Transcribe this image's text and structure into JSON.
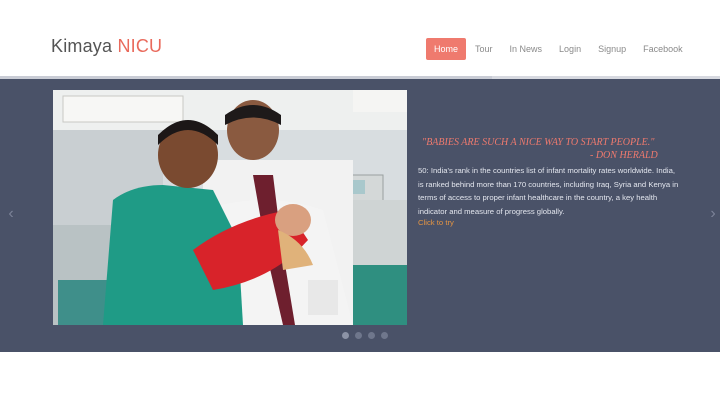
{
  "header": {
    "logo_main": "Kimaya",
    "logo_accent": "NICU"
  },
  "nav": {
    "items": [
      {
        "label": "Home",
        "active": true
      },
      {
        "label": "Tour",
        "active": false
      },
      {
        "label": "In News",
        "active": false
      },
      {
        "label": "Login",
        "active": false
      },
      {
        "label": "Signup",
        "active": false
      },
      {
        "label": "Facebook",
        "active": false
      }
    ]
  },
  "hero": {
    "image_alt": "Doctor and father holding newborn in NICU",
    "quote_line1": "\"BABIES ARE SUCH A NICE WAY TO START PEOPLE.\"",
    "quote_line2": "- DON HERALD",
    "description": "50: India's rank in the countries list of infant mortality rates worldwide. India, is ranked behind more than 170 countries, including Iraq, Syria and Kenya in terms of access to proper infant healthcare in the country, a key health indicator and measure of progress globally.",
    "cta": "Click to try",
    "prev_icon": "chevron-left-icon",
    "next_icon": "chevron-right-icon",
    "slide_count": 4,
    "active_slide": 1
  },
  "colors": {
    "accent": "#ef7a6e",
    "slider_bg": "#4a5268",
    "link": "#e29444"
  }
}
